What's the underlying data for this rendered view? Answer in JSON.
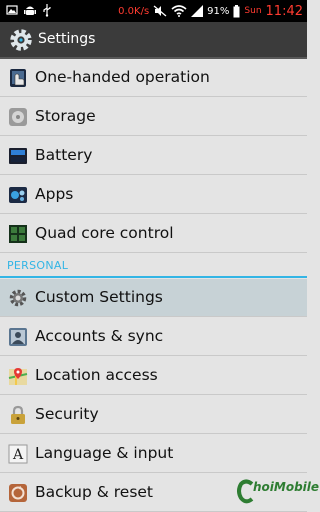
{
  "status_bar": {
    "speed": "0.0K/s",
    "battery_percent": "91%",
    "day": "Sun",
    "time": "11:42",
    "icons": [
      "image-icon",
      "android-icon",
      "usb-icon",
      "mute-icon",
      "wifi-icon",
      "signal-icon",
      "battery-icon"
    ]
  },
  "action_bar": {
    "title": "Settings",
    "icon": "gear-icon"
  },
  "list": {
    "items": [
      {
        "label": "One-handed operation",
        "icon": "one-hand-icon"
      },
      {
        "label": "Storage",
        "icon": "storage-icon"
      },
      {
        "label": "Battery",
        "icon": "battery-icon"
      },
      {
        "label": "Apps",
        "icon": "apps-icon"
      },
      {
        "label": "Quad core control",
        "icon": "chip-icon"
      }
    ],
    "section_header": "PERSONAL",
    "personal_items": [
      {
        "label": "Custom Settings",
        "icon": "gear-icon",
        "selected": true
      },
      {
        "label": "Accounts & sync",
        "icon": "account-icon"
      },
      {
        "label": "Location access",
        "icon": "location-icon"
      },
      {
        "label": "Security",
        "icon": "lock-icon"
      },
      {
        "label": "Language & input",
        "icon": "language-icon"
      },
      {
        "label": "Backup & reset",
        "icon": "backup-icon"
      }
    ]
  },
  "watermark": {
    "brand": "hoiMobile"
  },
  "colors": {
    "accent": "#33b5e5",
    "status_red": "#ff3b30",
    "selected_row": "#c7d2d6"
  }
}
